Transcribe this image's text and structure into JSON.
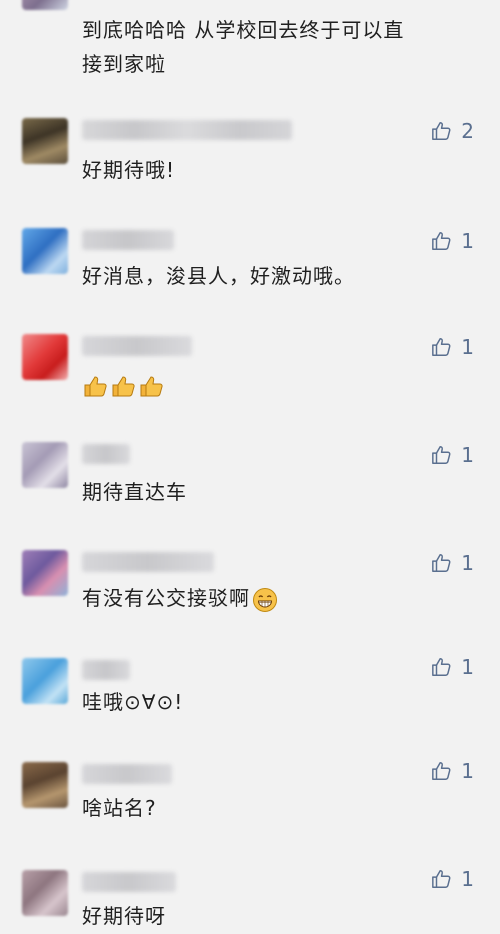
{
  "comments": [
    {
      "text_line1": "到底哈哈哈  从学校回去终于可以直",
      "text_line2": "接到家啦",
      "likes": ""
    },
    {
      "text": "好期待哦!",
      "likes": "2"
    },
    {
      "text": "好消息，浚县人，好激动哦。",
      "likes": "1"
    },
    {
      "text": "",
      "likes": "1",
      "emoji": "thumbs-up x3"
    },
    {
      "text": "期待直达车",
      "likes": "1"
    },
    {
      "text": "有没有公交接驳啊",
      "likes": "1",
      "emoji": "grin"
    },
    {
      "text": "哇哦⊙∀⊙!",
      "likes": "1"
    },
    {
      "text": "啥站名?",
      "likes": "1"
    },
    {
      "text": "好期待呀",
      "likes": "1"
    }
  ]
}
